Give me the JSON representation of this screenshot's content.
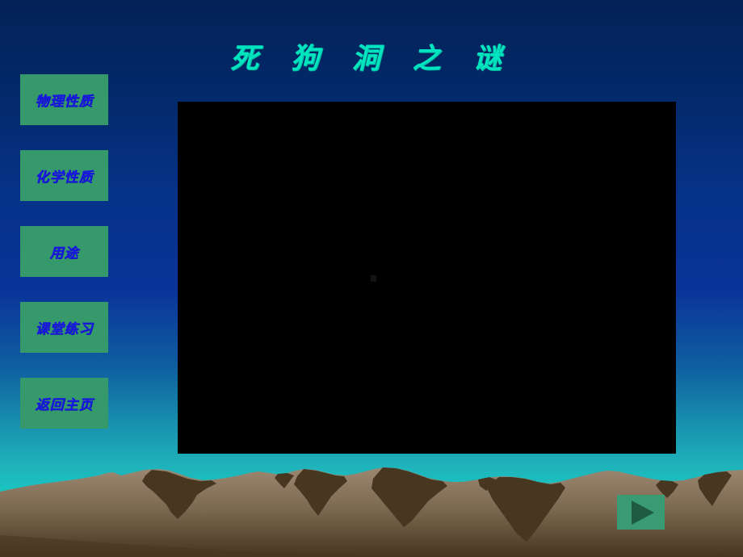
{
  "slide": {
    "title": "死 狗 洞 之 谜",
    "title_color": "#00e5c0",
    "background_top_color": "#032157",
    "background_bottom_color": "#0ce5cb"
  },
  "sidebar": {
    "button_bg_color": "#35996b",
    "button_text_color": "#1919e0",
    "items": [
      {
        "label": "物理性质",
        "name": "physical-properties"
      },
      {
        "label": "化学性质",
        "name": "chemical-properties"
      },
      {
        "label": "用途",
        "name": "uses"
      },
      {
        "label": "课堂练习",
        "name": "class-exercises"
      },
      {
        "label": "返回主页",
        "name": "return-home"
      }
    ]
  },
  "media": {
    "label": "",
    "background_color": "#000000"
  },
  "controls": {
    "play_label": "",
    "play_icon": "play-triangle-icon",
    "play_bg_color": "#3a9a71",
    "play_icon_color": "#1f5a43"
  },
  "landscape": {
    "mountain_light_color": "#9c8770",
    "mountain_dark_color": "#473620"
  }
}
